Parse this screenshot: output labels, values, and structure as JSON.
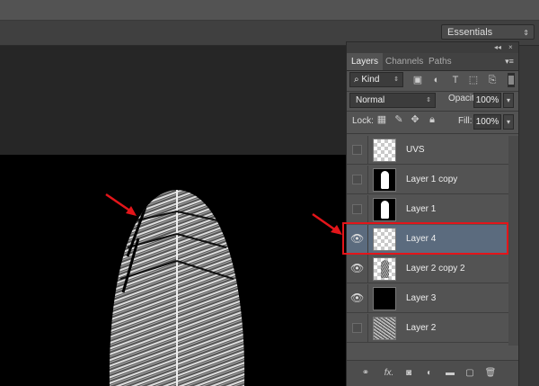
{
  "workspace": {
    "label": "Essentials"
  },
  "panel": {
    "tabs": [
      {
        "label": "Layers",
        "active": true
      },
      {
        "label": "Channels",
        "active": false
      },
      {
        "label": "Paths",
        "active": false
      }
    ],
    "filter": {
      "kind_label": "Kind",
      "icons": [
        "image-filter-icon",
        "adjustment-filter-icon",
        "type-filter-icon",
        "shape-filter-icon",
        "smart-object-filter-icon"
      ]
    },
    "blend_mode": "Normal",
    "opacity_label": "Opacity:",
    "opacity_value": "100%",
    "lock_label": "Lock:",
    "fill_label": "Fill:",
    "fill_value": "100%",
    "layers": [
      {
        "name": "UVS",
        "visible": false,
        "thumb": "checker",
        "selected": false
      },
      {
        "name": "Layer 1 copy",
        "visible": false,
        "thumb": "black-white-shape",
        "selected": false
      },
      {
        "name": "Layer 1",
        "visible": false,
        "thumb": "black-white-shape",
        "selected": false
      },
      {
        "name": "Layer 4",
        "visible": true,
        "thumb": "checker",
        "selected": true
      },
      {
        "name": "Layer 2 copy 2",
        "visible": true,
        "thumb": "checker-grey-shape",
        "selected": false
      },
      {
        "name": "Layer 3",
        "visible": true,
        "thumb": "black",
        "selected": false
      },
      {
        "name": "Layer 2",
        "visible": false,
        "thumb": "noise",
        "selected": false
      }
    ]
  },
  "colors": {
    "highlight": "#e3151a",
    "selected_row": "#5b6b7e",
    "panel_bg": "#535353"
  }
}
